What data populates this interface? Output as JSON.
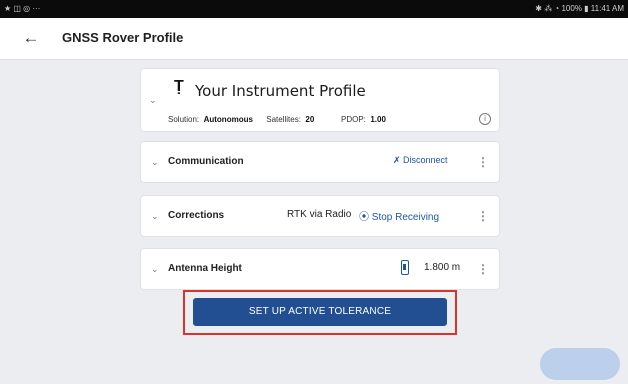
{
  "status_bar": {
    "left_icons": "★ ◫ ◎ ···",
    "right_text": "✱ ⁂ ◔ 100% ▮ 11:41 AM"
  },
  "app_bar": {
    "back_icon": "←",
    "title": "GNSS Rover Profile"
  },
  "profile_card": {
    "chevron": "⌄",
    "icon": "Ṭ",
    "title": "Your Instrument Profile",
    "solution_label": "Solution:",
    "solution_value": "Autonomous",
    "satellites_label": "Satellites:",
    "satellites_value": "20",
    "pdop_label": "PDOP:",
    "pdop_value": "1.00",
    "info_icon": "i"
  },
  "communication": {
    "chevron": "⌄",
    "title": "Communication",
    "action": "✗ Disconnect",
    "kebab": "⋮"
  },
  "corrections": {
    "chevron": "⌄",
    "title": "Corrections",
    "value": "RTK via Radio",
    "action": "⦿ Stop Receiving",
    "kebab": "⋮"
  },
  "antenna_height": {
    "chevron": "⌄",
    "title": "Antenna Height",
    "value": "1.800 m",
    "kebab": "⋮"
  },
  "tolerance_button": {
    "label": "SET UP ACTIVE TOLERANCE"
  },
  "colors": {
    "accent": "#214f91",
    "link": "#1e56a6",
    "highlight": "#d9342b"
  }
}
